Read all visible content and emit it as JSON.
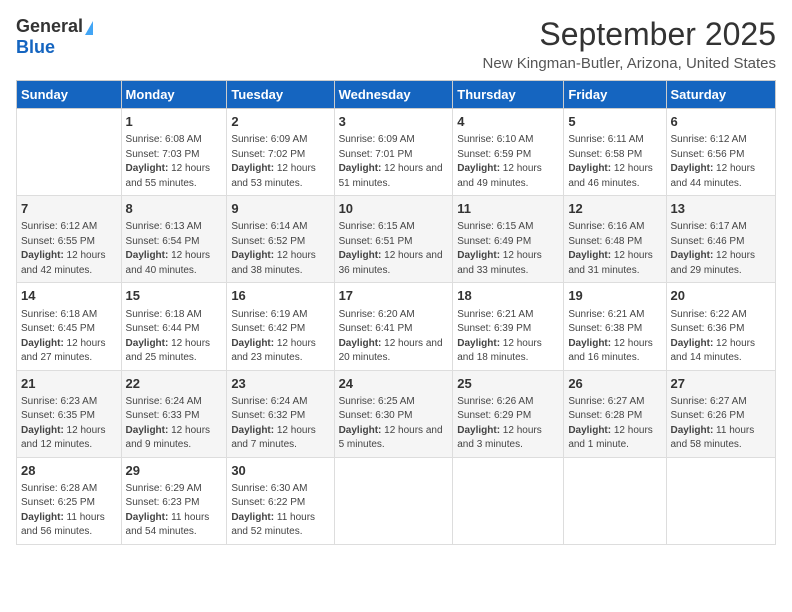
{
  "logo": {
    "general": "General",
    "blue": "Blue"
  },
  "title": "September 2025",
  "subtitle": "New Kingman-Butler, Arizona, United States",
  "days_of_week": [
    "Sunday",
    "Monday",
    "Tuesday",
    "Wednesday",
    "Thursday",
    "Friday",
    "Saturday"
  ],
  "weeks": [
    [
      {
        "day": "",
        "info": ""
      },
      {
        "day": "1",
        "sunrise": "6:08 AM",
        "sunset": "7:03 PM",
        "daylight": "12 hours and 55 minutes."
      },
      {
        "day": "2",
        "sunrise": "6:09 AM",
        "sunset": "7:02 PM",
        "daylight": "12 hours and 53 minutes."
      },
      {
        "day": "3",
        "sunrise": "6:09 AM",
        "sunset": "7:01 PM",
        "daylight": "12 hours and 51 minutes."
      },
      {
        "day": "4",
        "sunrise": "6:10 AM",
        "sunset": "6:59 PM",
        "daylight": "12 hours and 49 minutes."
      },
      {
        "day": "5",
        "sunrise": "6:11 AM",
        "sunset": "6:58 PM",
        "daylight": "12 hours and 46 minutes."
      },
      {
        "day": "6",
        "sunrise": "6:12 AM",
        "sunset": "6:56 PM",
        "daylight": "12 hours and 44 minutes."
      }
    ],
    [
      {
        "day": "7",
        "sunrise": "6:12 AM",
        "sunset": "6:55 PM",
        "daylight": "12 hours and 42 minutes."
      },
      {
        "day": "8",
        "sunrise": "6:13 AM",
        "sunset": "6:54 PM",
        "daylight": "12 hours and 40 minutes."
      },
      {
        "day": "9",
        "sunrise": "6:14 AM",
        "sunset": "6:52 PM",
        "daylight": "12 hours and 38 minutes."
      },
      {
        "day": "10",
        "sunrise": "6:15 AM",
        "sunset": "6:51 PM",
        "daylight": "12 hours and 36 minutes."
      },
      {
        "day": "11",
        "sunrise": "6:15 AM",
        "sunset": "6:49 PM",
        "daylight": "12 hours and 33 minutes."
      },
      {
        "day": "12",
        "sunrise": "6:16 AM",
        "sunset": "6:48 PM",
        "daylight": "12 hours and 31 minutes."
      },
      {
        "day": "13",
        "sunrise": "6:17 AM",
        "sunset": "6:46 PM",
        "daylight": "12 hours and 29 minutes."
      }
    ],
    [
      {
        "day": "14",
        "sunrise": "6:18 AM",
        "sunset": "6:45 PM",
        "daylight": "12 hours and 27 minutes."
      },
      {
        "day": "15",
        "sunrise": "6:18 AM",
        "sunset": "6:44 PM",
        "daylight": "12 hours and 25 minutes."
      },
      {
        "day": "16",
        "sunrise": "6:19 AM",
        "sunset": "6:42 PM",
        "daylight": "12 hours and 23 minutes."
      },
      {
        "day": "17",
        "sunrise": "6:20 AM",
        "sunset": "6:41 PM",
        "daylight": "12 hours and 20 minutes."
      },
      {
        "day": "18",
        "sunrise": "6:21 AM",
        "sunset": "6:39 PM",
        "daylight": "12 hours and 18 minutes."
      },
      {
        "day": "19",
        "sunrise": "6:21 AM",
        "sunset": "6:38 PM",
        "daylight": "12 hours and 16 minutes."
      },
      {
        "day": "20",
        "sunrise": "6:22 AM",
        "sunset": "6:36 PM",
        "daylight": "12 hours and 14 minutes."
      }
    ],
    [
      {
        "day": "21",
        "sunrise": "6:23 AM",
        "sunset": "6:35 PM",
        "daylight": "12 hours and 12 minutes."
      },
      {
        "day": "22",
        "sunrise": "6:24 AM",
        "sunset": "6:33 PM",
        "daylight": "12 hours and 9 minutes."
      },
      {
        "day": "23",
        "sunrise": "6:24 AM",
        "sunset": "6:32 PM",
        "daylight": "12 hours and 7 minutes."
      },
      {
        "day": "24",
        "sunrise": "6:25 AM",
        "sunset": "6:30 PM",
        "daylight": "12 hours and 5 minutes."
      },
      {
        "day": "25",
        "sunrise": "6:26 AM",
        "sunset": "6:29 PM",
        "daylight": "12 hours and 3 minutes."
      },
      {
        "day": "26",
        "sunrise": "6:27 AM",
        "sunset": "6:28 PM",
        "daylight": "12 hours and 1 minute."
      },
      {
        "day": "27",
        "sunrise": "6:27 AM",
        "sunset": "6:26 PM",
        "daylight": "11 hours and 58 minutes."
      }
    ],
    [
      {
        "day": "28",
        "sunrise": "6:28 AM",
        "sunset": "6:25 PM",
        "daylight": "11 hours and 56 minutes."
      },
      {
        "day": "29",
        "sunrise": "6:29 AM",
        "sunset": "6:23 PM",
        "daylight": "11 hours and 54 minutes."
      },
      {
        "day": "30",
        "sunrise": "6:30 AM",
        "sunset": "6:22 PM",
        "daylight": "11 hours and 52 minutes."
      },
      {
        "day": "",
        "info": ""
      },
      {
        "day": "",
        "info": ""
      },
      {
        "day": "",
        "info": ""
      },
      {
        "day": "",
        "info": ""
      }
    ]
  ]
}
